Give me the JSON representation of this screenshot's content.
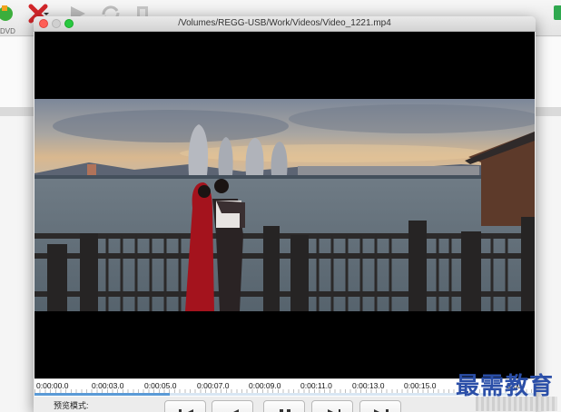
{
  "background_app": {
    "toolbar_icons": [
      "add-green-icon",
      "delete-red-x-icon",
      "play-gray-icon",
      "convert-gray-icon",
      "burn-gray-icon"
    ],
    "dvd_label": "DVD"
  },
  "preview_window": {
    "title": "/Volumes/REGG-USB/Work/Videos/Video_1221.mp4",
    "timeline": {
      "tick_labels": [
        "0:00:00.0",
        "0:00:03.0",
        "0:00:05.0",
        "0:00:07.0",
        "0:00:09.0",
        "0:00:11.0",
        "0:00:13.0",
        "0:00:15.0",
        "0:00:"
      ],
      "progress": 0.27
    },
    "controls": {
      "mode_label": "预览模式:",
      "buttons": [
        "skip-to-start-icon",
        "step-back-icon",
        "pause-icon",
        "step-forward-icon",
        "skip-to-end-icon"
      ]
    }
  },
  "watermark": {
    "text": "最需教育"
  },
  "colors": {
    "close": "#fe5f57",
    "minimize": "#febc2e",
    "zoom": "#28c840",
    "watermark": "#2b4fa8",
    "timeline_progress": "#5a9ad6"
  }
}
